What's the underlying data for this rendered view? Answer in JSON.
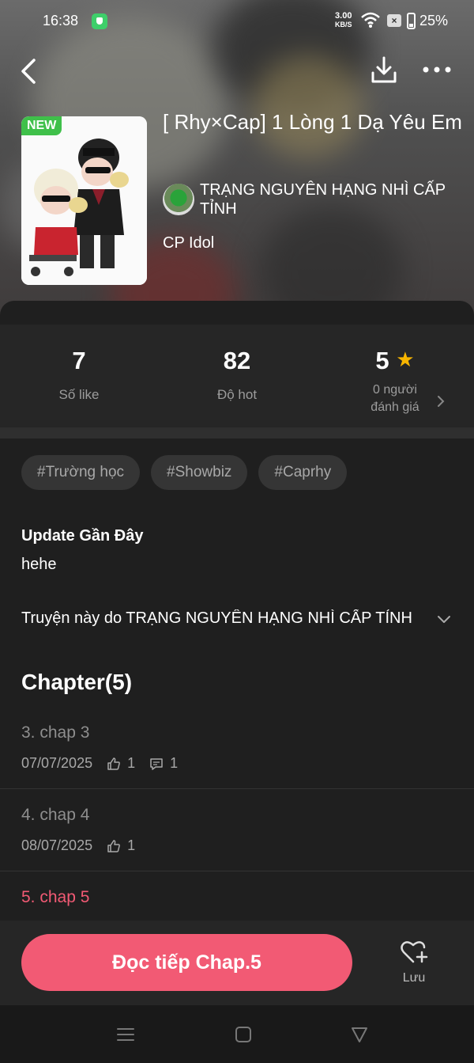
{
  "status_bar": {
    "time": "16:38",
    "net_speed_value": "3.00",
    "net_speed_unit": "KB/S",
    "battery": "25%"
  },
  "story": {
    "badge": "NEW",
    "title": "[ Rhy×Cap] 1 Lòng 1 Dạ Yêu Em",
    "author": "TRẠNG NGUYÊN HẠNG NHÌ CẤP TỈNH",
    "category": "CP Idol"
  },
  "stats": {
    "likes_value": "7",
    "likes_label": "Số like",
    "hot_value": "82",
    "hot_label": "Độ hot",
    "rating_value": "5",
    "rating_label_line1": "0 người",
    "rating_label_line2": "đánh giá"
  },
  "tags": [
    "#Trường học",
    "#Showbiz",
    "#Caprhy"
  ],
  "update": {
    "title": "Update Gần Đây",
    "body": "hehe"
  },
  "description": "Truyện này do TRẠNG NGUYÊN HẠNG NHÌ CẤP TỈNH",
  "chapters": {
    "heading": "Chapter(5)",
    "items": [
      {
        "name": "3. chap 3",
        "date": "07/07/2025",
        "likes": "1",
        "comments": "1"
      },
      {
        "name": "4. chap 4",
        "date": "08/07/2025",
        "likes": "1"
      },
      {
        "name": "5. chap 5"
      }
    ]
  },
  "actions": {
    "read_label": "Đọc tiếp Chap.5",
    "save_label": "Lưu"
  },
  "colors": {
    "accent": "#f25a74",
    "new_badge": "#3fc04a",
    "star": "#f7b500"
  }
}
